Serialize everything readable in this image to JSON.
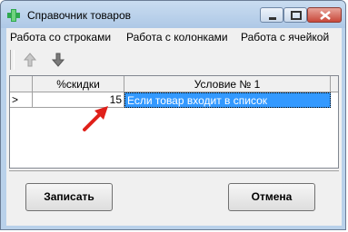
{
  "window": {
    "title": "Справочник товаров",
    "app_icon": "green-cross-icon",
    "controls": [
      "minimize-icon",
      "maximize-icon",
      "close-icon"
    ],
    "accent": "#3399ff"
  },
  "menu": {
    "items": [
      "Работа со строками",
      "Работа с колонками",
      "Работа с ячейкой"
    ]
  },
  "toolbar": {
    "buttons": [
      "move-up-arrow-icon",
      "move-down-arrow-icon"
    ]
  },
  "grid": {
    "columns": [
      "",
      "%скидки",
      "Условие № 1"
    ],
    "rows": [
      {
        "marker": ">",
        "discount": "15",
        "condition": "Если товар входит в список"
      }
    ]
  },
  "buttons": {
    "save": "Записать",
    "cancel": "Отмена"
  }
}
